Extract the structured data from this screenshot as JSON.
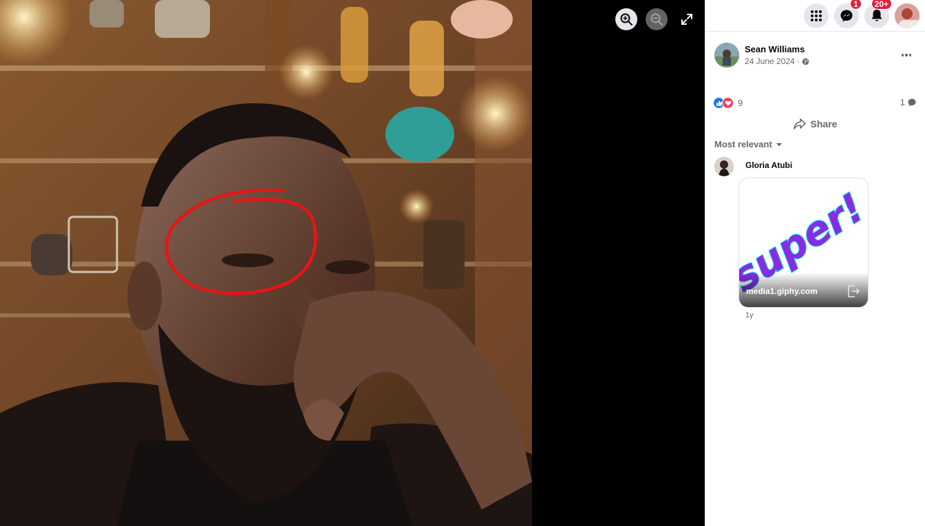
{
  "viewer": {
    "photo_alt": "Photo",
    "zoom_in_icon": "zoom-in-icon",
    "zoom_out_icon": "zoom-out-icon",
    "fullscreen_icon": "expand-icon"
  },
  "topbar": {
    "menu_icon": "grid-menu-icon",
    "messenger_badge": "1",
    "notifications_badge": "20+"
  },
  "post": {
    "author": "Sean Williams",
    "date": "24 June 2024",
    "date_separator": "·",
    "privacy_icon": "globe-icon",
    "reaction_count": "9",
    "comment_count": "1",
    "share_label": "Share"
  },
  "comments": {
    "sort_label": "Most relevant",
    "items": [
      {
        "name": "Gloria Atubi",
        "gif_text": "super!",
        "gif_source": "media1.giphy.com",
        "time": "1y"
      }
    ]
  },
  "colors": {
    "accent": "#1877f2",
    "love": "#f33e58",
    "badge": "#e41e3f",
    "annotation": "#e81515"
  }
}
